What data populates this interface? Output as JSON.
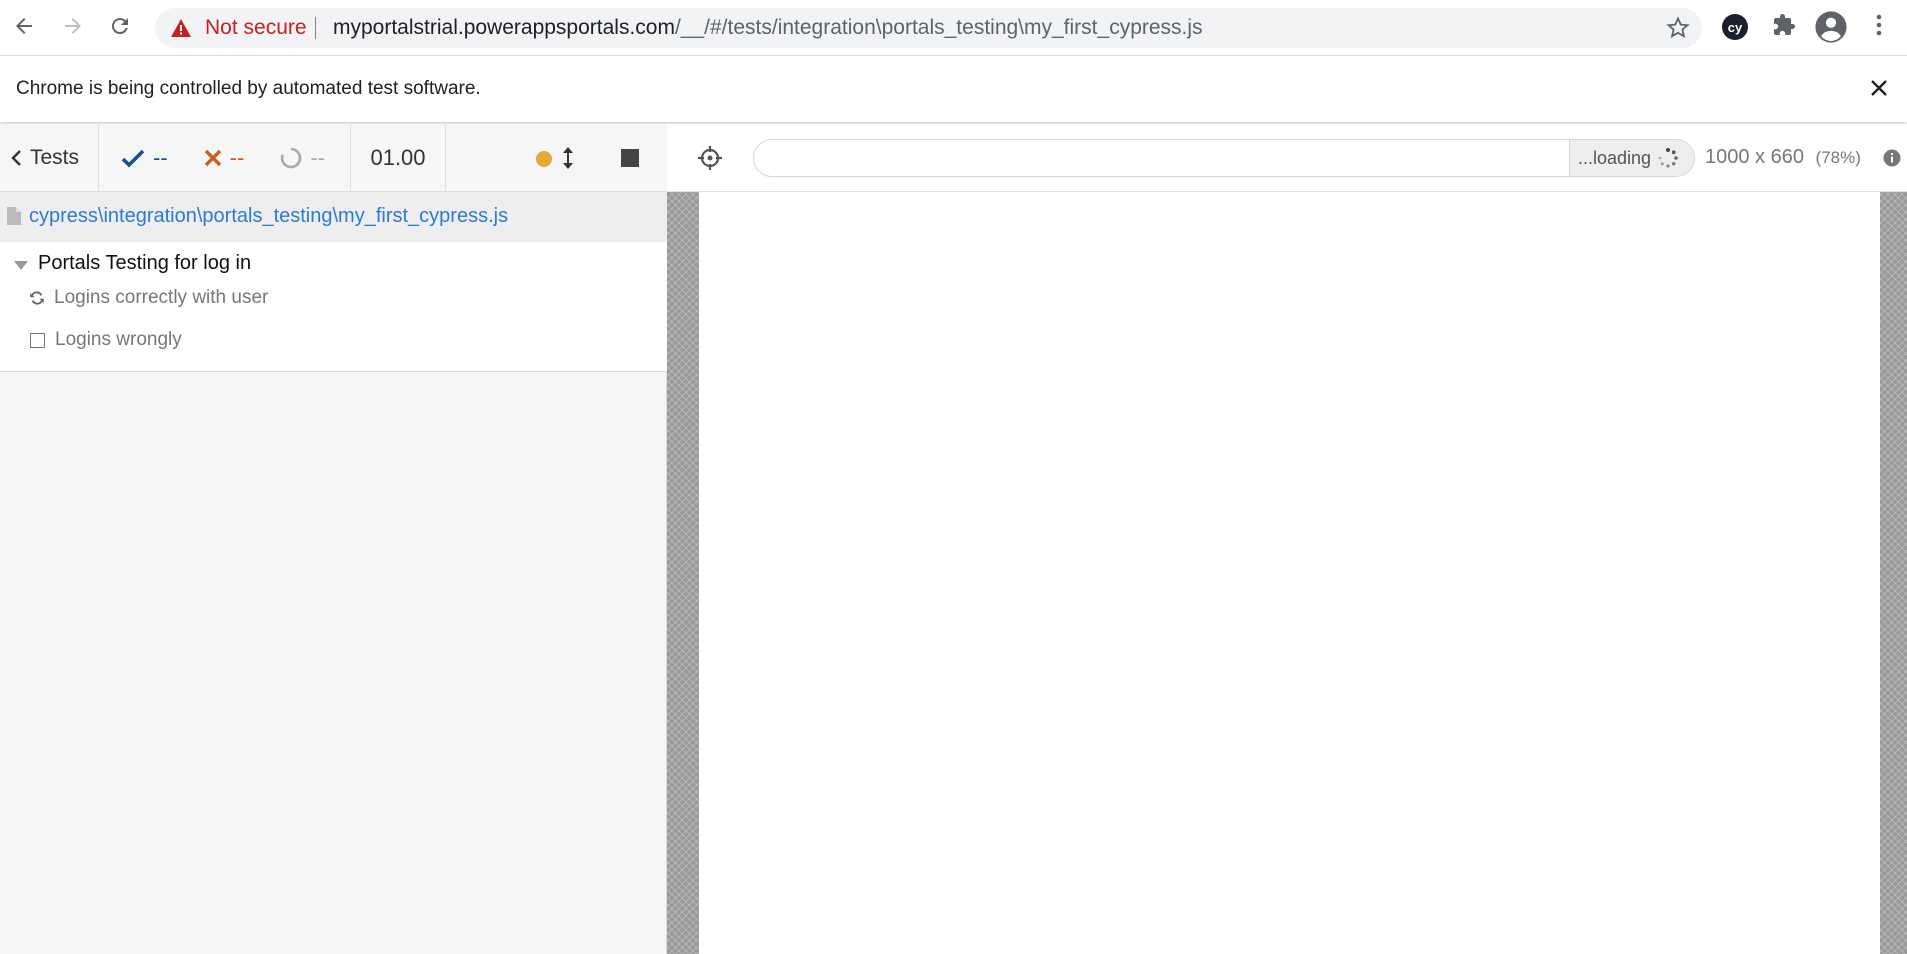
{
  "browser": {
    "security_label": "Not secure",
    "url_host": "myportalstrial.powerappsportals.com",
    "url_path": "/__/#/tests/integration\\portals_testing\\my_first_cypress.js",
    "extension_label": "cy"
  },
  "info_bar": {
    "message": "Chrome is being controlled by automated test software."
  },
  "reporter": {
    "tests_link": "Tests",
    "passed": "--",
    "failed": "--",
    "pending": "--",
    "duration": "01.00",
    "spec_path": "cypress\\integration\\portals_testing\\my_first_cypress.js",
    "suite": {
      "title": "Portals Testing for log in",
      "tests": [
        {
          "title": "Logins correctly with user",
          "state": "running"
        },
        {
          "title": "Logins wrongly",
          "state": "pending"
        }
      ]
    }
  },
  "aut": {
    "url_value": "",
    "loading_label": "...loading",
    "viewport_size": "1000 x 660",
    "viewport_scale": "(78%)"
  },
  "colors": {
    "passed": "#1d4f91",
    "failed": "#c95e23",
    "running_dot": "#e8a73a",
    "spec_link": "#2b7bd6",
    "not_secure": "#c5221f"
  }
}
